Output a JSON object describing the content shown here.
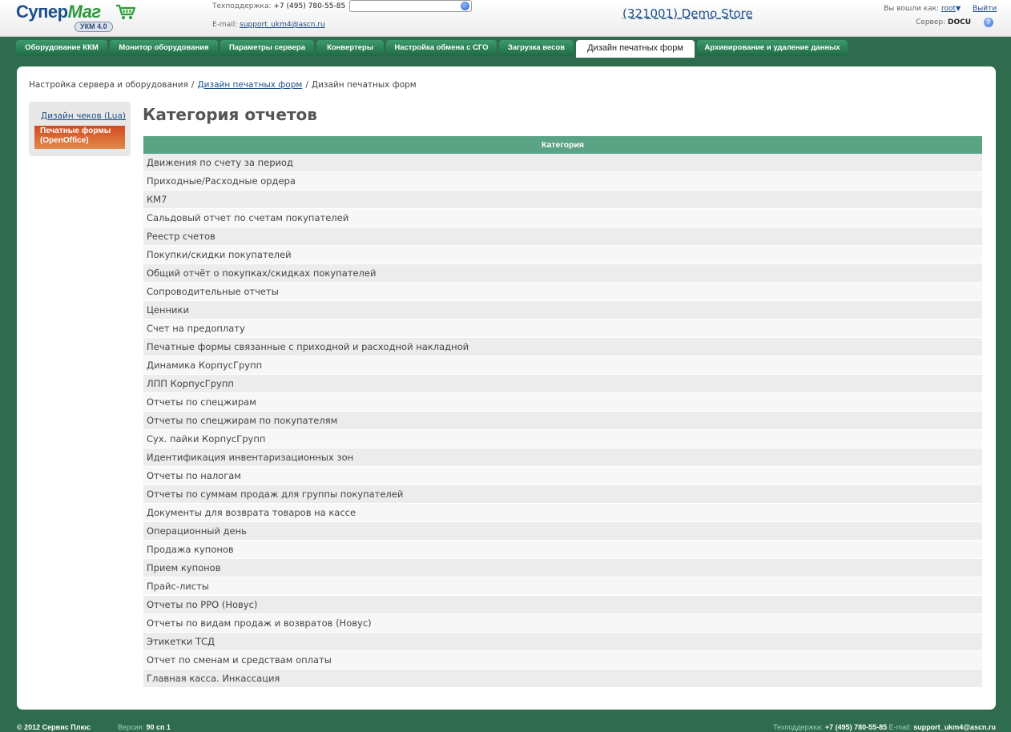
{
  "header": {
    "logo_main": "Супер",
    "logo_accent": "Маг",
    "logo_version": "УКМ 4.0",
    "support_label": "Техподдержка:",
    "support_phone": "+7 (495) 780-55-85",
    "email_label": "E-mail:",
    "email_value": "support_ukm4@ascn.ru",
    "search_placeholder": "",
    "store_name": "(321001) Demo Store",
    "login_label": "Вы вошли как:",
    "login_user": "root",
    "logout_label": "Выйти",
    "server_label": "Сервер:",
    "server_value": "DOCU"
  },
  "nav": {
    "tabs": [
      {
        "label": "Оборудование ККМ"
      },
      {
        "label": "Монитор оборудования"
      },
      {
        "label": "Параметры сервера"
      },
      {
        "label": "Конвертеры"
      },
      {
        "label": "Настройка обмена с СГО"
      },
      {
        "label": "Загрузка весов"
      },
      {
        "label": "Дизайн печатных форм"
      },
      {
        "label": "Архивирование и удаление данных"
      }
    ]
  },
  "breadcrumb": {
    "root": "Настройка сервера и оборудования",
    "link": "Дизайн печатных форм",
    "current": "Дизайн печатных форм"
  },
  "sidebar": {
    "link": "Дизайн чеков (Lua)",
    "active_line1": "Печатные формы",
    "active_line2": "(OpenOffice)"
  },
  "main": {
    "title": "Категория отчетов",
    "column_header": "Категория",
    "rows": [
      "Движения по счету за период",
      "Приходные/Расходные ордера",
      "КМ7",
      "Сальдовый отчет по счетам покупателей",
      "Реестр счетов",
      "Покупки/скидки покупателей",
      "Общий отчёт о покупках/скидках покупателей",
      "Сопроводительные отчеты",
      "Ценники",
      "Счет на предоплату",
      "Печатные формы связанные с приходной и расходной накладной",
      "Динамика КорпусГрупп",
      "ЛПП КорпусГрупп",
      "Отчеты по спецжирам",
      "Отчеты по спецжирам по покупателям",
      "Сух. пайки КорпусГрупп",
      "Идентификация инвентаризационных зон",
      "Отчеты по налогам",
      "Отчеты по суммам продаж для группы покупателей",
      "Документы для возврата товаров на кассе",
      "Операционный день",
      "Продажа купонов",
      "Прием купонов",
      "Прайс-листы",
      "Отчеты по РРО (Новус)",
      "Отчеты по видам продаж и возвратов (Новус)",
      "Этикетки ТСД",
      "Отчет по сменам и средствам оплаты",
      "Главная касса. Инкассация"
    ]
  },
  "footer": {
    "copyright": "© 2012 Сервис Плюс",
    "version_label": "Версия:",
    "version_value": "90 сп 1",
    "support_label": "Техподдержка:",
    "support_phone": "+7 (495) 780-55-85",
    "email_label": "E-mail:",
    "email_value": "support_ukm4@ascn.ru"
  },
  "colors": {
    "background": "#2e6b4f",
    "tab": "#2a7d55",
    "table_header": "#5aa384",
    "active_side": "#d24a1f",
    "link": "#1d4f8a"
  }
}
